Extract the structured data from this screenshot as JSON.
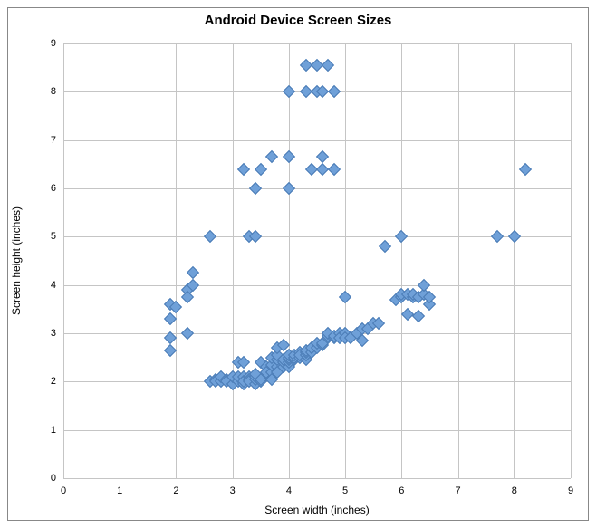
{
  "chart_data": {
    "type": "scatter",
    "title": "Android Device Screen Sizes",
    "xlabel": "Screen width (inches)",
    "ylabel": "Screen height (inches)",
    "xlim": [
      0,
      9
    ],
    "ylim": [
      0,
      9
    ],
    "xticks": [
      0,
      1,
      2,
      3,
      4,
      5,
      6,
      7,
      8,
      9
    ],
    "yticks": [
      0,
      1,
      2,
      3,
      4,
      5,
      6,
      7,
      8,
      9
    ],
    "marker_color": "#6fa0d8",
    "points": [
      [
        1.9,
        3.6
      ],
      [
        1.9,
        3.3
      ],
      [
        1.9,
        2.9
      ],
      [
        1.9,
        2.65
      ],
      [
        2.0,
        3.55
      ],
      [
        2.2,
        3.9
      ],
      [
        2.2,
        3.0
      ],
      [
        2.2,
        3.75
      ],
      [
        2.3,
        4.0
      ],
      [
        2.3,
        4.25
      ],
      [
        2.6,
        2.0
      ],
      [
        2.6,
        5.0
      ],
      [
        2.7,
        2.05
      ],
      [
        2.7,
        2.0
      ],
      [
        2.8,
        2.0
      ],
      [
        2.8,
        2.1
      ],
      [
        2.9,
        2.05
      ],
      [
        2.9,
        2.0
      ],
      [
        3.0,
        1.95
      ],
      [
        3.0,
        2.1
      ],
      [
        3.1,
        2.0
      ],
      [
        3.1,
        2.1
      ],
      [
        3.1,
        2.4
      ],
      [
        3.2,
        6.4
      ],
      [
        3.2,
        2.4
      ],
      [
        3.2,
        1.95
      ],
      [
        3.2,
        2.1
      ],
      [
        3.2,
        2.0
      ],
      [
        3.3,
        2.1
      ],
      [
        3.3,
        2.05
      ],
      [
        3.3,
        2.0
      ],
      [
        3.3,
        5.0
      ],
      [
        3.4,
        1.95
      ],
      [
        3.4,
        2.05
      ],
      [
        3.4,
        2.1
      ],
      [
        3.4,
        2.15
      ],
      [
        3.4,
        5.0
      ],
      [
        3.4,
        6.0
      ],
      [
        3.5,
        2.0
      ],
      [
        3.5,
        2.05
      ],
      [
        3.5,
        2.4
      ],
      [
        3.5,
        6.4
      ],
      [
        3.6,
        2.3
      ],
      [
        3.6,
        2.2
      ],
      [
        3.7,
        2.2
      ],
      [
        3.7,
        2.35
      ],
      [
        3.7,
        2.05
      ],
      [
        3.7,
        2.5
      ],
      [
        3.7,
        6.65
      ],
      [
        3.8,
        2.3
      ],
      [
        3.8,
        2.2
      ],
      [
        3.8,
        2.45
      ],
      [
        3.8,
        2.55
      ],
      [
        3.8,
        2.7
      ],
      [
        3.9,
        2.3
      ],
      [
        3.9,
        2.4
      ],
      [
        3.9,
        2.45
      ],
      [
        3.9,
        2.75
      ],
      [
        4.0,
        2.3
      ],
      [
        4.0,
        2.4
      ],
      [
        4.0,
        2.45
      ],
      [
        4.0,
        2.5
      ],
      [
        4.0,
        2.55
      ],
      [
        4.0,
        6.0
      ],
      [
        4.0,
        6.65
      ],
      [
        4.0,
        8.0
      ],
      [
        4.1,
        2.45
      ],
      [
        4.1,
        2.5
      ],
      [
        4.1,
        2.55
      ],
      [
        4.2,
        2.5
      ],
      [
        4.2,
        2.6
      ],
      [
        4.2,
        2.55
      ],
      [
        4.3,
        2.45
      ],
      [
        4.3,
        2.55
      ],
      [
        4.3,
        2.6
      ],
      [
        4.3,
        2.65
      ],
      [
        4.3,
        8.0
      ],
      [
        4.3,
        8.55
      ],
      [
        4.4,
        2.6
      ],
      [
        4.4,
        2.7
      ],
      [
        4.4,
        6.4
      ],
      [
        4.5,
        2.7
      ],
      [
        4.5,
        2.8
      ],
      [
        4.5,
        8.0
      ],
      [
        4.5,
        8.55
      ],
      [
        4.6,
        2.75
      ],
      [
        4.6,
        2.8
      ],
      [
        4.6,
        6.4
      ],
      [
        4.6,
        6.65
      ],
      [
        4.6,
        8.0
      ],
      [
        4.7,
        2.9
      ],
      [
        4.7,
        2.95
      ],
      [
        4.7,
        3.0
      ],
      [
        4.7,
        8.55
      ],
      [
        4.8,
        2.9
      ],
      [
        4.8,
        2.95
      ],
      [
        4.8,
        6.4
      ],
      [
        4.8,
        8.0
      ],
      [
        4.9,
        3.0
      ],
      [
        4.9,
        2.9
      ],
      [
        5.0,
        3.0
      ],
      [
        5.0,
        2.9
      ],
      [
        5.0,
        3.75
      ],
      [
        5.1,
        2.9
      ],
      [
        5.2,
        3.0
      ],
      [
        5.3,
        3.1
      ],
      [
        5.3,
        2.85
      ],
      [
        5.4,
        3.1
      ],
      [
        5.5,
        3.2
      ],
      [
        5.6,
        3.2
      ],
      [
        5.7,
        4.8
      ],
      [
        5.9,
        3.7
      ],
      [
        6.0,
        3.75
      ],
      [
        6.0,
        3.8
      ],
      [
        6.0,
        5.0
      ],
      [
        6.1,
        3.8
      ],
      [
        6.1,
        3.4
      ],
      [
        6.2,
        3.75
      ],
      [
        6.2,
        3.8
      ],
      [
        6.3,
        3.75
      ],
      [
        6.3,
        3.35
      ],
      [
        6.4,
        3.8
      ],
      [
        6.4,
        4.0
      ],
      [
        6.5,
        3.6
      ],
      [
        6.5,
        3.75
      ],
      [
        7.7,
        5.0
      ],
      [
        8.0,
        5.0
      ],
      [
        8.2,
        6.4
      ]
    ]
  }
}
